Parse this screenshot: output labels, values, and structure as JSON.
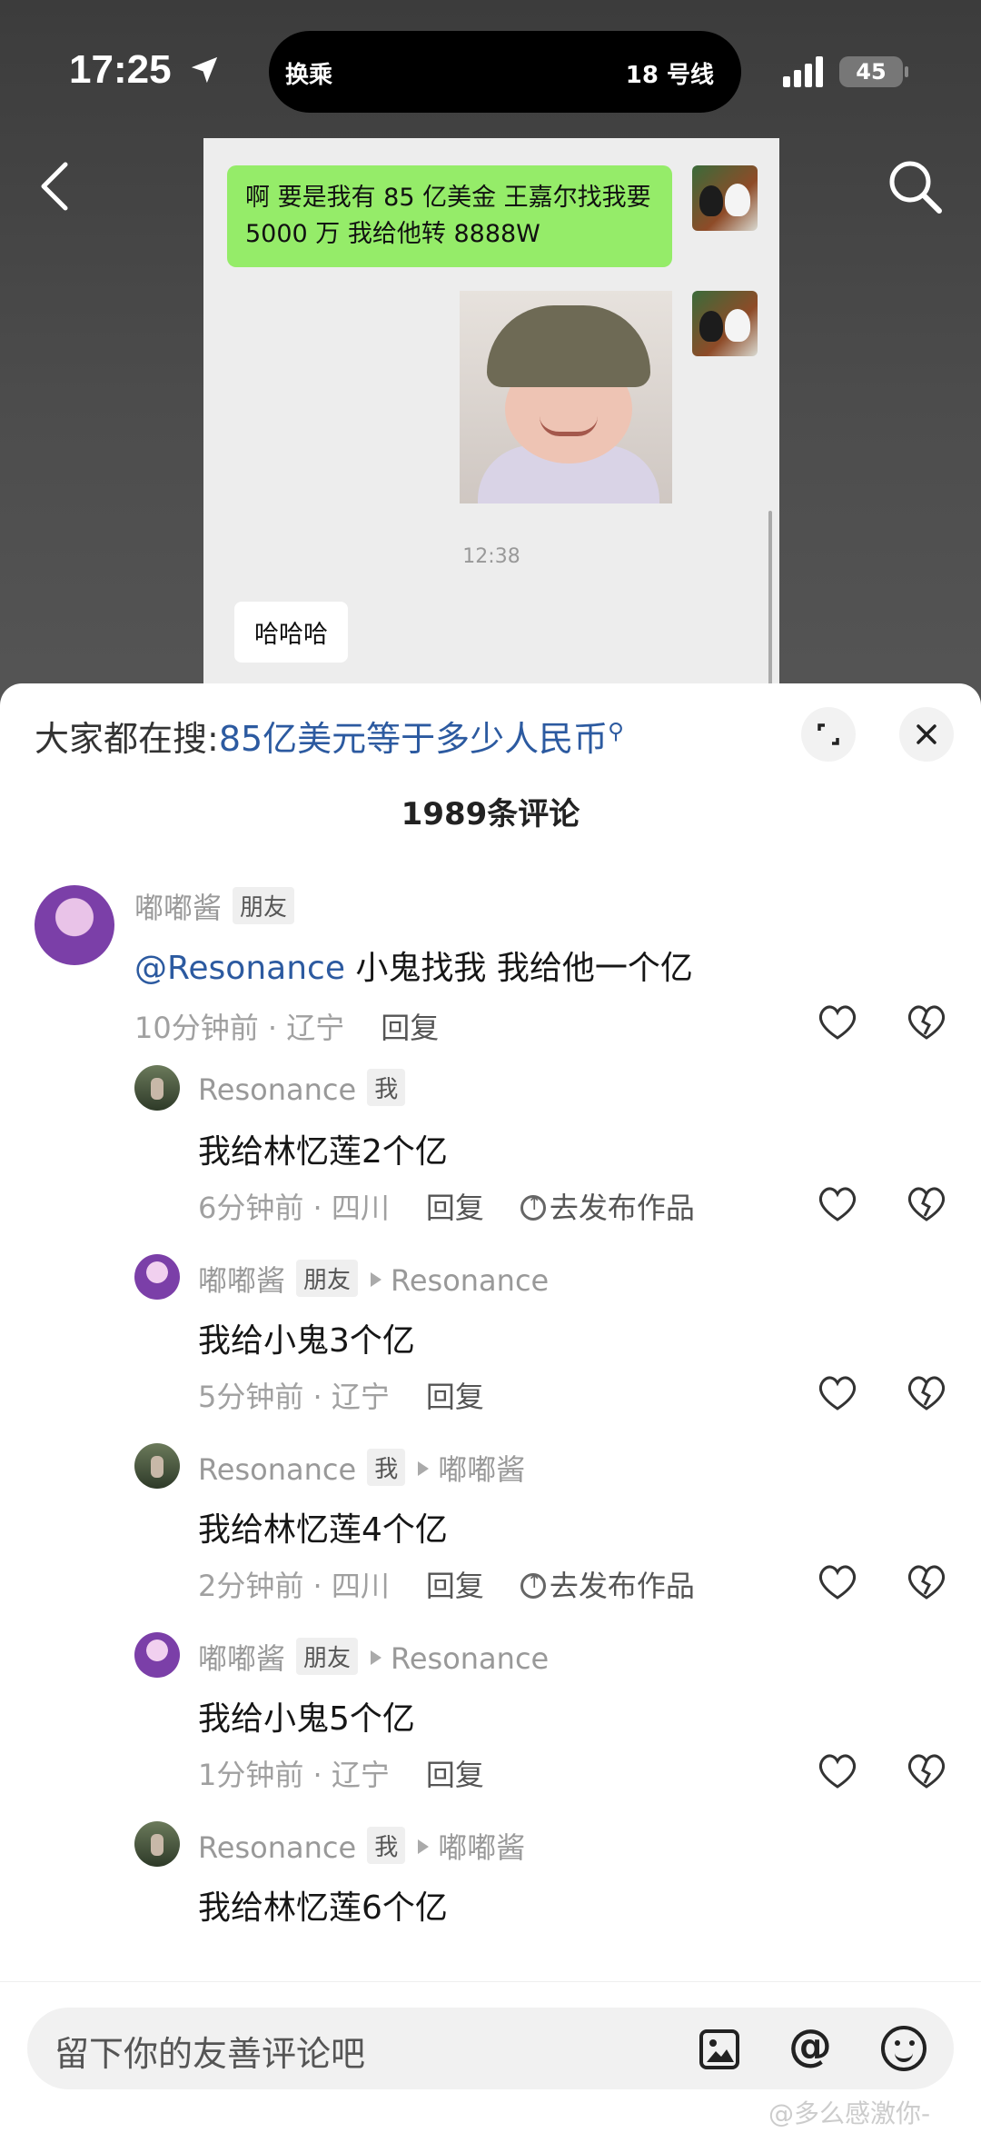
{
  "status": {
    "time": "17:25",
    "island_left": "换乘",
    "island_right": "18 号线",
    "battery": "45"
  },
  "chat": {
    "message_1": "啊 要是我有 85 亿美金 王嘉尔找我要 5000 万 我给他转 8888W",
    "time": "12:38",
    "message_2": "哈哈哈"
  },
  "sheet": {
    "search_prefix": "大家都在搜:",
    "search_keyword": "85亿美元等于多少人民币",
    "comment_count": "1989条评论",
    "reply_label": "回复",
    "publish_label": "去发布作品"
  },
  "comments": [
    {
      "name": "嘟嘟酱",
      "tag": "朋友",
      "mention": "@Resonance",
      "text": "小鬼找我 我给他一个亿",
      "meta": "10分钟前 · 辽宁"
    },
    {
      "name": "Resonance",
      "tag": "我",
      "text": "我给林忆莲2个亿",
      "meta": "6分钟前 · 四川"
    },
    {
      "name": "嘟嘟酱",
      "tag": "朋友",
      "reply_to": "Resonance",
      "text": "我给小鬼3个亿",
      "meta": "5分钟前 · 辽宁"
    },
    {
      "name": "Resonance",
      "tag": "我",
      "reply_to": "嘟嘟酱",
      "text": "我给林忆莲4个亿",
      "meta": "2分钟前 · 四川"
    },
    {
      "name": "嘟嘟酱",
      "tag": "朋友",
      "reply_to": "Resonance",
      "text": "我给小鬼5个亿",
      "meta": "1分钟前 · 辽宁"
    },
    {
      "name": "Resonance",
      "tag": "我",
      "reply_to": "嘟嘟酱",
      "text": "我给林忆莲6个亿"
    }
  ],
  "input": {
    "placeholder": "留下你的友善评论吧"
  },
  "watermark": "@多么感激你-"
}
